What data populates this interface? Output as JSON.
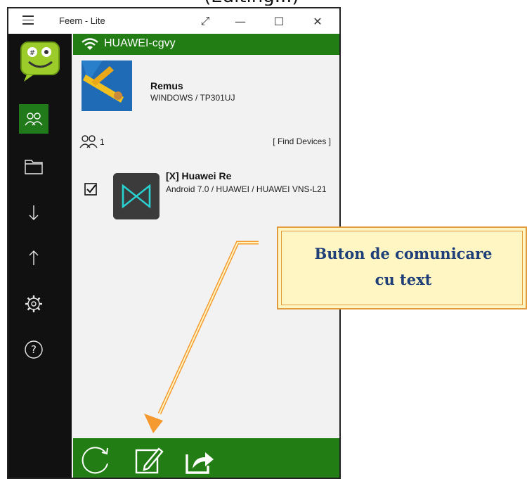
{
  "window": {
    "title": "Feem - Lite",
    "controls": {
      "expand": "⤢",
      "minimize": "—",
      "maximize": "☐",
      "close": "✕"
    }
  },
  "network": {
    "name": "HUAWEI-cgvy",
    "icon": "wifi-icon"
  },
  "local_device": {
    "name": "Remus",
    "detail": "WINDOWS / TP301UJ"
  },
  "devices_header": {
    "count": "1",
    "find_label": "[ Find Devices ]"
  },
  "devices": [
    {
      "name": "[X] Huawei Re",
      "detail": "Android 7.0 / HUAWEI / HUAWEI VNS-L21",
      "checked": true
    }
  ],
  "sidebar": {
    "items": [
      {
        "icon": "users-icon",
        "active": true
      },
      {
        "icon": "folder-icon",
        "active": false
      },
      {
        "icon": "download-arrow-icon",
        "active": false
      },
      {
        "icon": "upload-arrow-icon",
        "active": false
      },
      {
        "icon": "settings-gear-icon",
        "active": false
      },
      {
        "icon": "help-icon",
        "active": false
      }
    ]
  },
  "bottom_bar": {
    "buttons": [
      {
        "icon": "refresh-icon"
      },
      {
        "icon": "text-chat-icon"
      },
      {
        "icon": "share-icon"
      }
    ]
  },
  "annotation": {
    "line1": "Buton de comunicare",
    "line2": "cu text"
  },
  "colors": {
    "accent_green": "#217d14",
    "sidebar_bg": "#111111",
    "callout_bg": "#fff6c4",
    "callout_border": "#e39a3c",
    "callout_text": "#1f3f78",
    "arrow": "#f59a30"
  }
}
